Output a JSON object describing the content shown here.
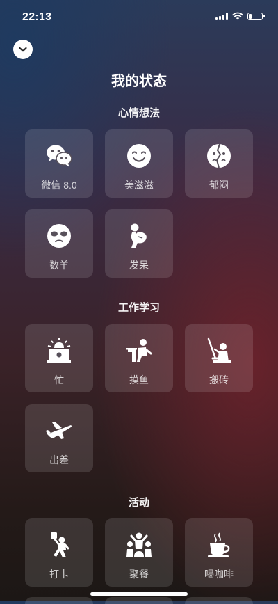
{
  "status": {
    "time": "22:13"
  },
  "header": {
    "title": "我的状态"
  },
  "sections": [
    {
      "title": "心情想法",
      "items": [
        {
          "label": "微信 8.0",
          "icon": "wechat-icon"
        },
        {
          "label": "美滋滋",
          "icon": "smile-face-icon"
        },
        {
          "label": "郁闷",
          "icon": "gloomy-face-icon"
        },
        {
          "label": "数羊",
          "icon": "sheep-face-icon"
        },
        {
          "label": "发呆",
          "icon": "daze-person-icon"
        }
      ]
    },
    {
      "title": "工作学习",
      "items": [
        {
          "label": "忙",
          "icon": "busy-alarm-icon"
        },
        {
          "label": "摸鱼",
          "icon": "slacking-desk-icon"
        },
        {
          "label": "搬砖",
          "icon": "brick-worker-icon"
        },
        {
          "label": "出差",
          "icon": "airplane-icon"
        }
      ]
    },
    {
      "title": "活动",
      "items": [
        {
          "label": "打卡",
          "icon": "check-in-person-icon"
        },
        {
          "label": "聚餐",
          "icon": "group-dinner-icon"
        },
        {
          "label": "喝咖啡",
          "icon": "coffee-cup-icon"
        }
      ]
    }
  ]
}
